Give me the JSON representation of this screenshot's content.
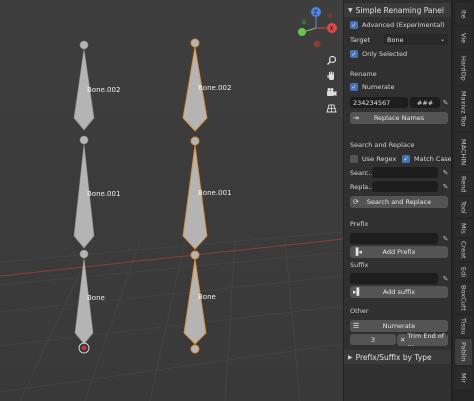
{
  "viewport": {
    "bone_labels": {
      "left_top": "Bone.002",
      "left_mid": "Bone.001",
      "left_bottom": "Bone",
      "right_top": "Bone.002",
      "right_mid": "Bone.001",
      "right_bottom": "Bone"
    },
    "gizmo": {
      "z_label": "Z",
      "x_label": "X"
    }
  },
  "panel": {
    "title": "Simple Renaming Panel",
    "advanced_label": "Advanced (Experimental)",
    "target_label": "Target",
    "target_value": "Bone",
    "only_selected_label": "Only Selected",
    "rename_title": "Rename",
    "numerate_label": "Numerate",
    "rename_value": "234234567",
    "hash_value": "###",
    "replace_names_button": "Replace Names",
    "search_replace_title": "Search and Replace",
    "use_regex_label": "Use Regex",
    "match_case_label": "Match Case",
    "search_label": "Searc...",
    "replace_label": "Repla...",
    "search_replace_button": "Search and Replace",
    "prefix_title": "Prefix",
    "add_prefix_button": "Add Prefix",
    "suffix_title": "Suffix",
    "add_suffix_button": "Add suffix",
    "other_title": "Other",
    "numerate_button": "Numerate",
    "trim_value": "3",
    "trim_button": "Trim End of ...",
    "prefix_suffix_type_title": "Prefix/Suffix by Type"
  },
  "tabs": [
    "Ite",
    "Vie",
    "HardOp",
    "Maxivz Too",
    "MACHIN",
    "Rend",
    "Tool",
    "Mis",
    "Creat",
    "Edi",
    "BoxCutt",
    "Tissu",
    "Pablin",
    "Mir"
  ]
}
